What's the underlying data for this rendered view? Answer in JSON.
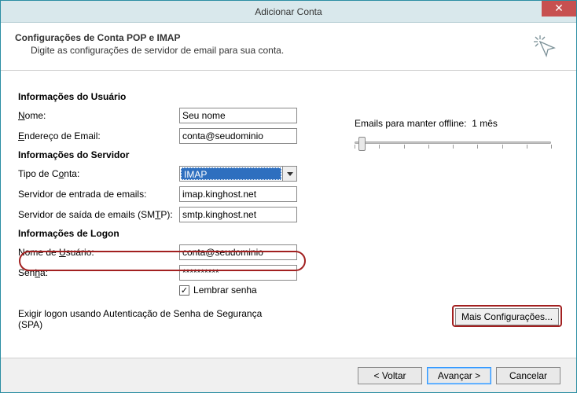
{
  "window": {
    "title": "Adicionar Conta"
  },
  "header": {
    "title": "Configurações de Conta POP e IMAP",
    "subtitle": "Digite as configurações de servidor de email para sua conta."
  },
  "sections": {
    "user": "Informações do Usuário",
    "server": "Informações do Servidor",
    "logon": "Informações de Logon"
  },
  "labels": {
    "name_pre": "",
    "name_u": "N",
    "name_post": "ome:",
    "email_pre": "",
    "email_u": "E",
    "email_post": "ndereço de Email:",
    "accttype_pre": "Tipo de C",
    "accttype_u": "o",
    "accttype_post": "nta:",
    "incoming": "Servidor de entrada de emails:",
    "outgoing_pre": "Servidor de saída de emails (SM",
    "outgoing_u": "T",
    "outgoing_post": "P):",
    "username_pre": "Nome de ",
    "username_u": "U",
    "username_post": "suário:",
    "password_pre": "Sen",
    "password_u": "h",
    "password_post": "a:",
    "remember_pre": "",
    "remember_u": "L",
    "remember_post": "embrar senha",
    "spa_pre": "E",
    "spa_u": "x",
    "spa_post": "igir logon usando Autenticação de Senha de Segurança (SPA)",
    "offline_pre": "Emails para manter offline:",
    "offline_val": "1 mês",
    "more_pre": "",
    "more_u": "M",
    "more_post": "ais Configurações..."
  },
  "values": {
    "name": "Seu nome",
    "email": "conta@seudominio",
    "account_type": "IMAP",
    "incoming": "imap.kinghost.net",
    "outgoing": "smtp.kinghost.net",
    "username": "conta@seudominio",
    "password": "**********",
    "remember_checked": "✓",
    "spa_checked": ""
  },
  "footer": {
    "back": "< Voltar",
    "next_pre": "",
    "next_u": "A",
    "next_post": "vançar >",
    "cancel": "Cancelar"
  }
}
